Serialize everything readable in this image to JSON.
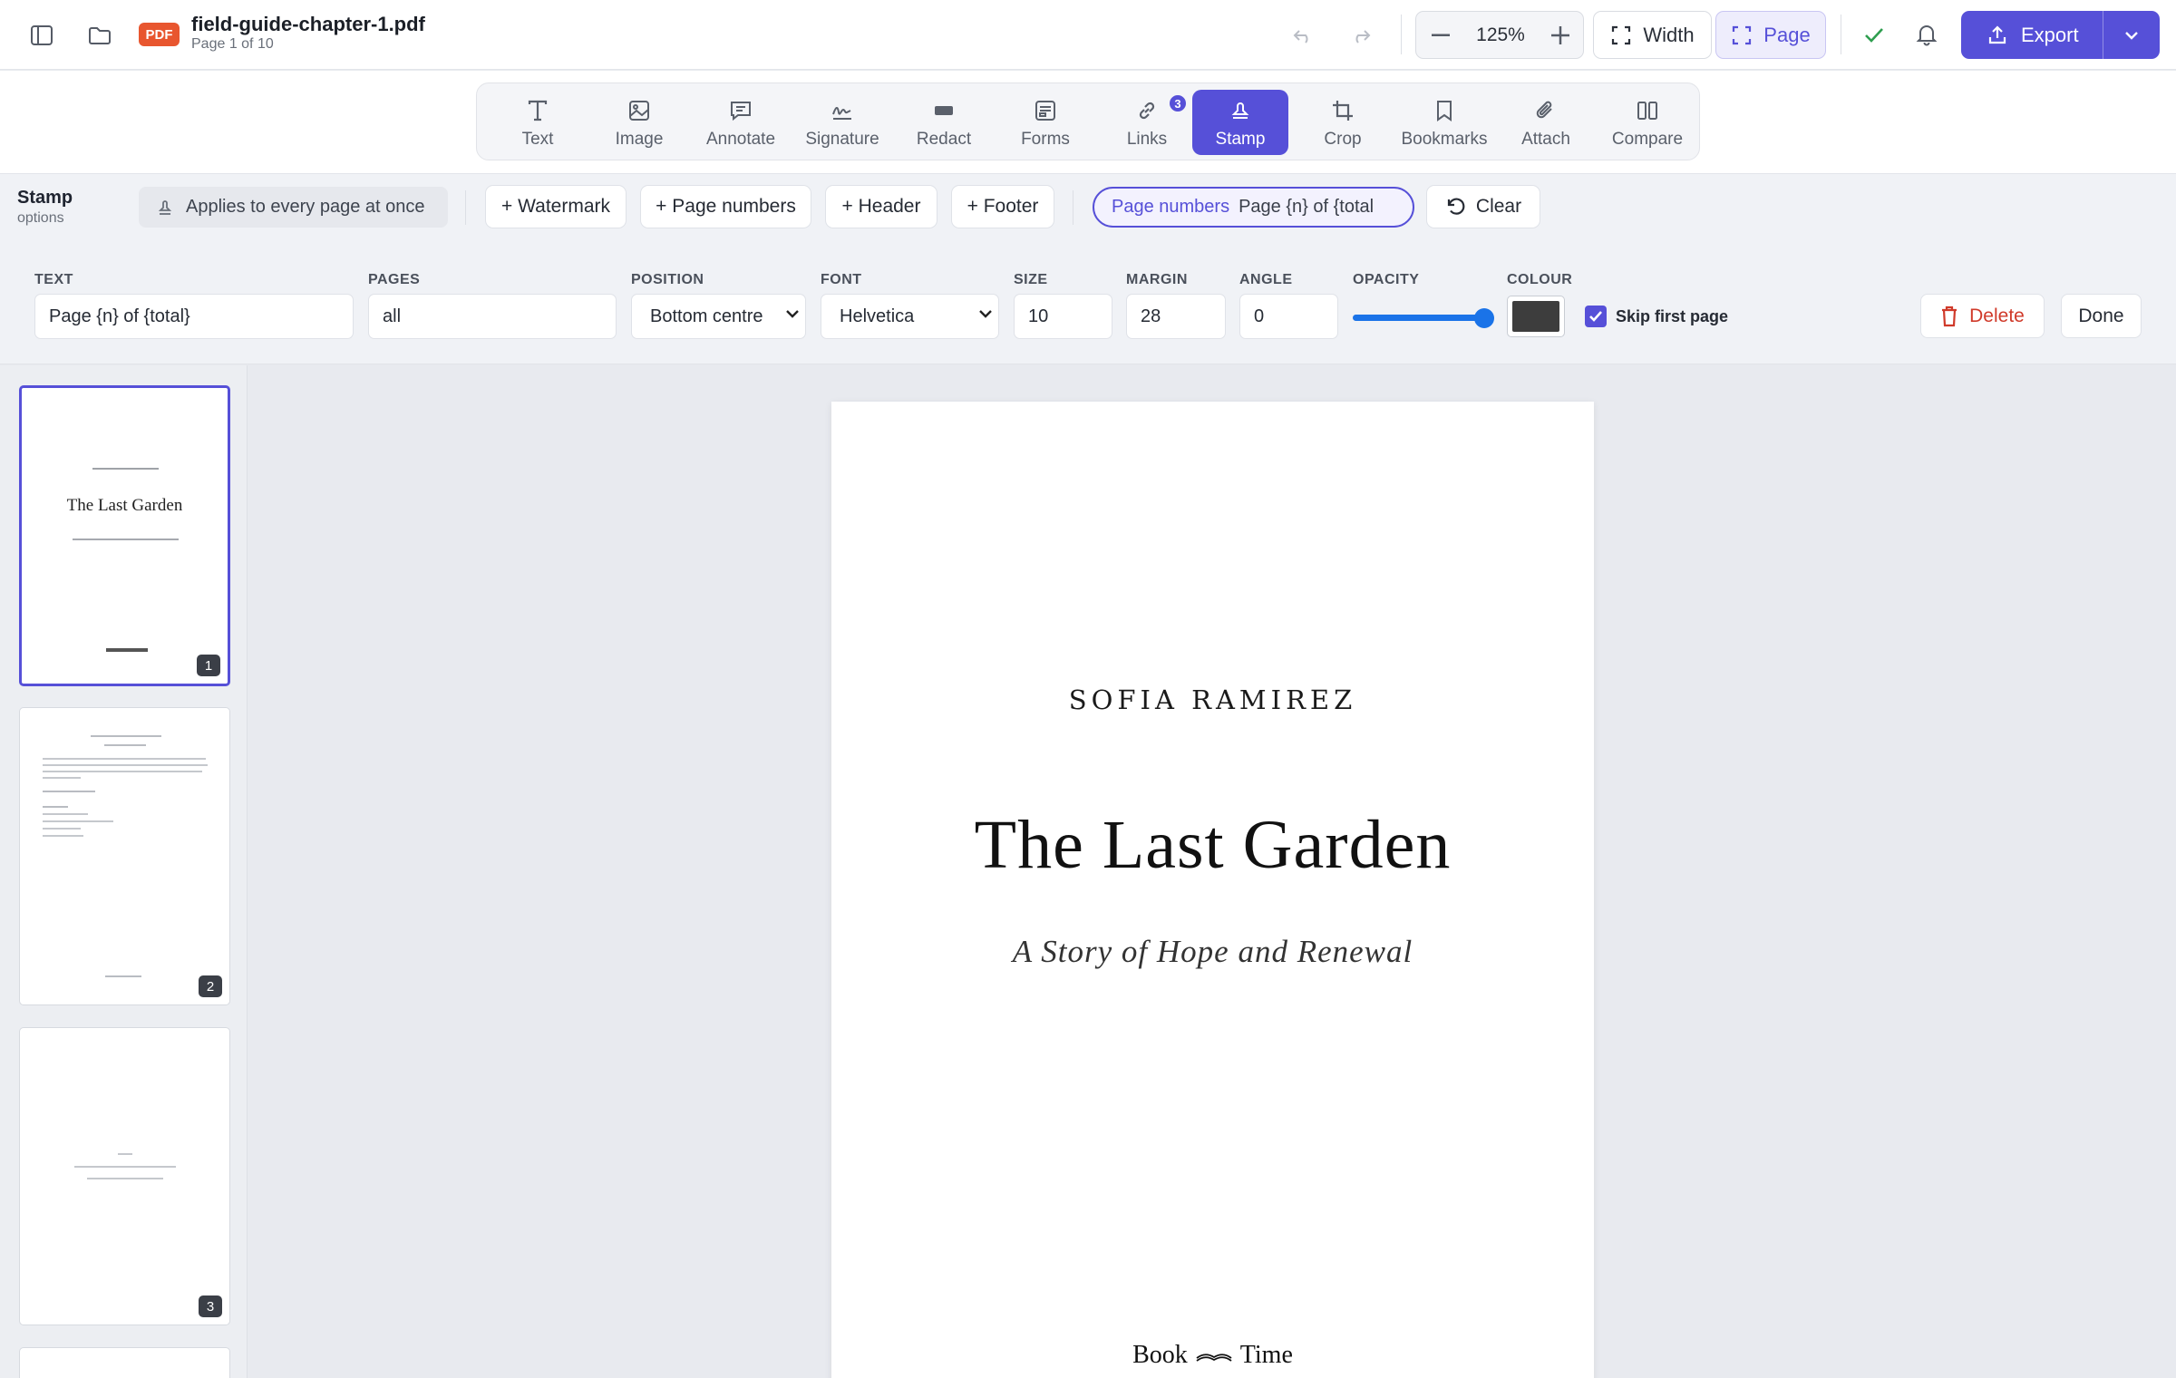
{
  "header": {
    "file_badge": "PDF",
    "file_name": "field-guide-chapter-1.pdf",
    "page_status": "Page 1 of 10",
    "zoom": "125%",
    "fit_width_label": "Width",
    "fit_page_label": "Page",
    "export_label": "Export"
  },
  "tools": [
    {
      "label": "Text",
      "icon": "text-icon"
    },
    {
      "label": "Image",
      "icon": "image-icon"
    },
    {
      "label": "Annotate",
      "icon": "comment-icon"
    },
    {
      "label": "Signature",
      "icon": "signature-icon"
    },
    {
      "label": "Redact",
      "icon": "redact-icon"
    },
    {
      "label": "Forms",
      "icon": "form-icon"
    },
    {
      "label": "Links",
      "icon": "link-icon",
      "badge": "3"
    },
    {
      "label": "Stamp",
      "icon": "stamp-icon",
      "active": true
    },
    {
      "label": "Crop",
      "icon": "crop-icon"
    },
    {
      "label": "Bookmarks",
      "icon": "bookmark-icon"
    },
    {
      "label": "Attach",
      "icon": "paperclip-icon"
    },
    {
      "label": "Compare",
      "icon": "compare-icon"
    }
  ],
  "stamp": {
    "title": "Stamp",
    "subtitle": "options",
    "hint": "Applies to every page at once",
    "presets": [
      "+ Watermark",
      "+ Page numbers",
      "+ Header",
      "+ Footer"
    ],
    "active_chip_type": "Page numbers",
    "active_chip_value": "Page {n} of {total",
    "clear_label": "Clear",
    "fields": {
      "text_label": "TEXT",
      "text_value": "Page {n} of {total}",
      "pages_label": "PAGES",
      "pages_value": "all",
      "position_label": "POSITION",
      "position_value": "Bottom centre",
      "font_label": "FONT",
      "font_value": "Helvetica",
      "size_label": "SIZE",
      "size_value": "10",
      "margin_label": "MARGIN",
      "margin_value": "28",
      "angle_label": "ANGLE",
      "angle_value": "0",
      "opacity_label": "OPACITY",
      "opacity_value": 1.0,
      "colour_label": "COLOUR",
      "colour_value": "#3d3d3d",
      "skip_first_label": "Skip first page",
      "skip_first_checked": true
    },
    "delete_label": "Delete",
    "done_label": "Done"
  },
  "thumbnails": [
    {
      "num": "1",
      "title": "The Last Garden"
    },
    {
      "num": "2"
    },
    {
      "num": "3"
    }
  ],
  "page": {
    "author": "SOFIA RAMIREZ",
    "title": "The Last Garden",
    "subtitle": "A Story of Hope and Renewal",
    "publisher_left": "Book",
    "publisher_right": "Time"
  },
  "colors": {
    "accent": "#5650d8",
    "pdf_badge": "#e8562f",
    "check": "#2e9e4f",
    "delete": "#d03a2a"
  }
}
